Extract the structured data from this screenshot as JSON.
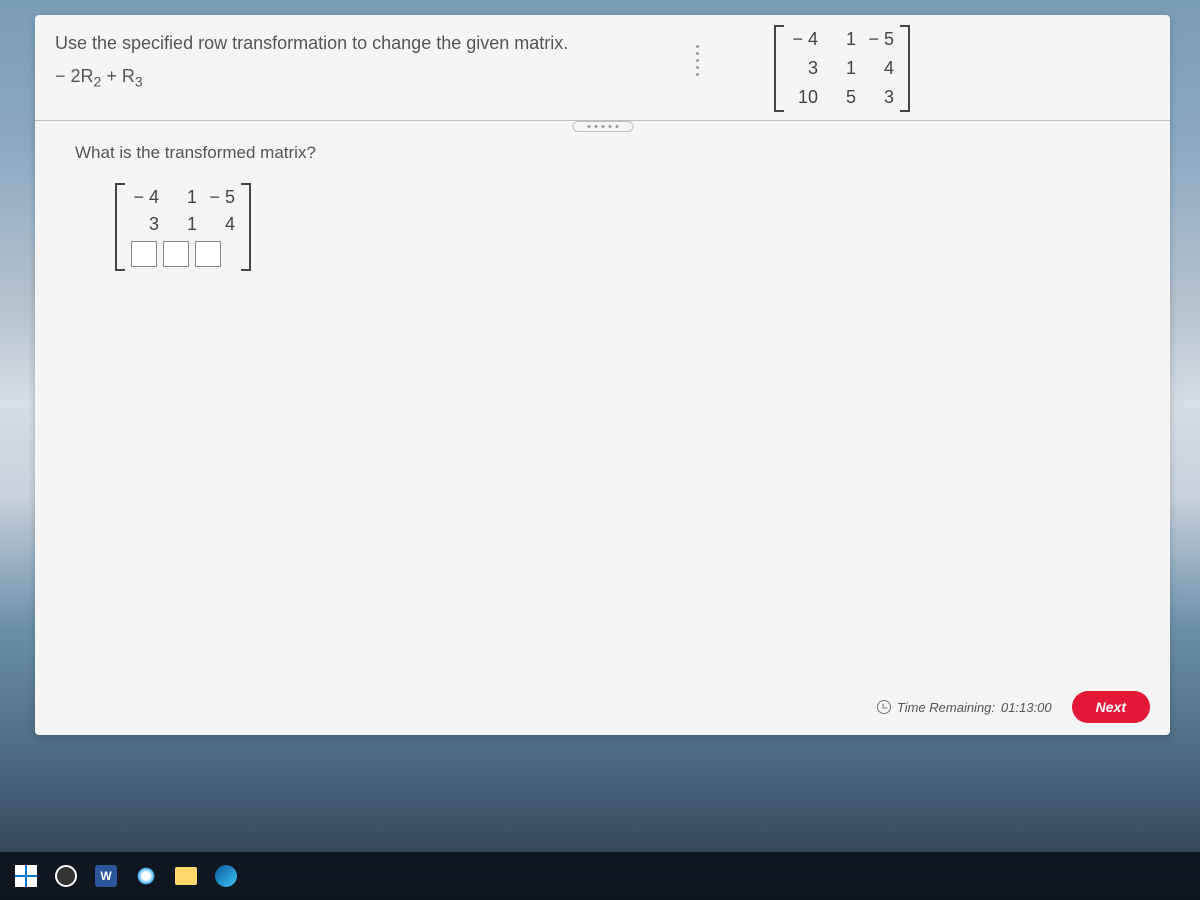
{
  "question": {
    "instruction": "Use the specified row transformation to change the given matrix.",
    "operation_prefix": "− 2R",
    "operation_sub1": "2",
    "operation_mid": " + R",
    "operation_sub2": "3",
    "given_matrix": {
      "rows": [
        [
          "− 4",
          "1",
          "− 5"
        ],
        [
          "3",
          "1",
          "4"
        ],
        [
          "10",
          "5",
          "3"
        ]
      ]
    }
  },
  "answer": {
    "prompt": "What is the transformed matrix?",
    "prefilled_rows": [
      [
        "− 4",
        "1",
        "− 5"
      ],
      [
        "3",
        "1",
        "4"
      ]
    ],
    "input_count": 3
  },
  "footer": {
    "time_label": "Time Remaining:",
    "time_value": "01:13:00",
    "next_label": "Next"
  },
  "taskbar": {
    "word_label": "W"
  }
}
